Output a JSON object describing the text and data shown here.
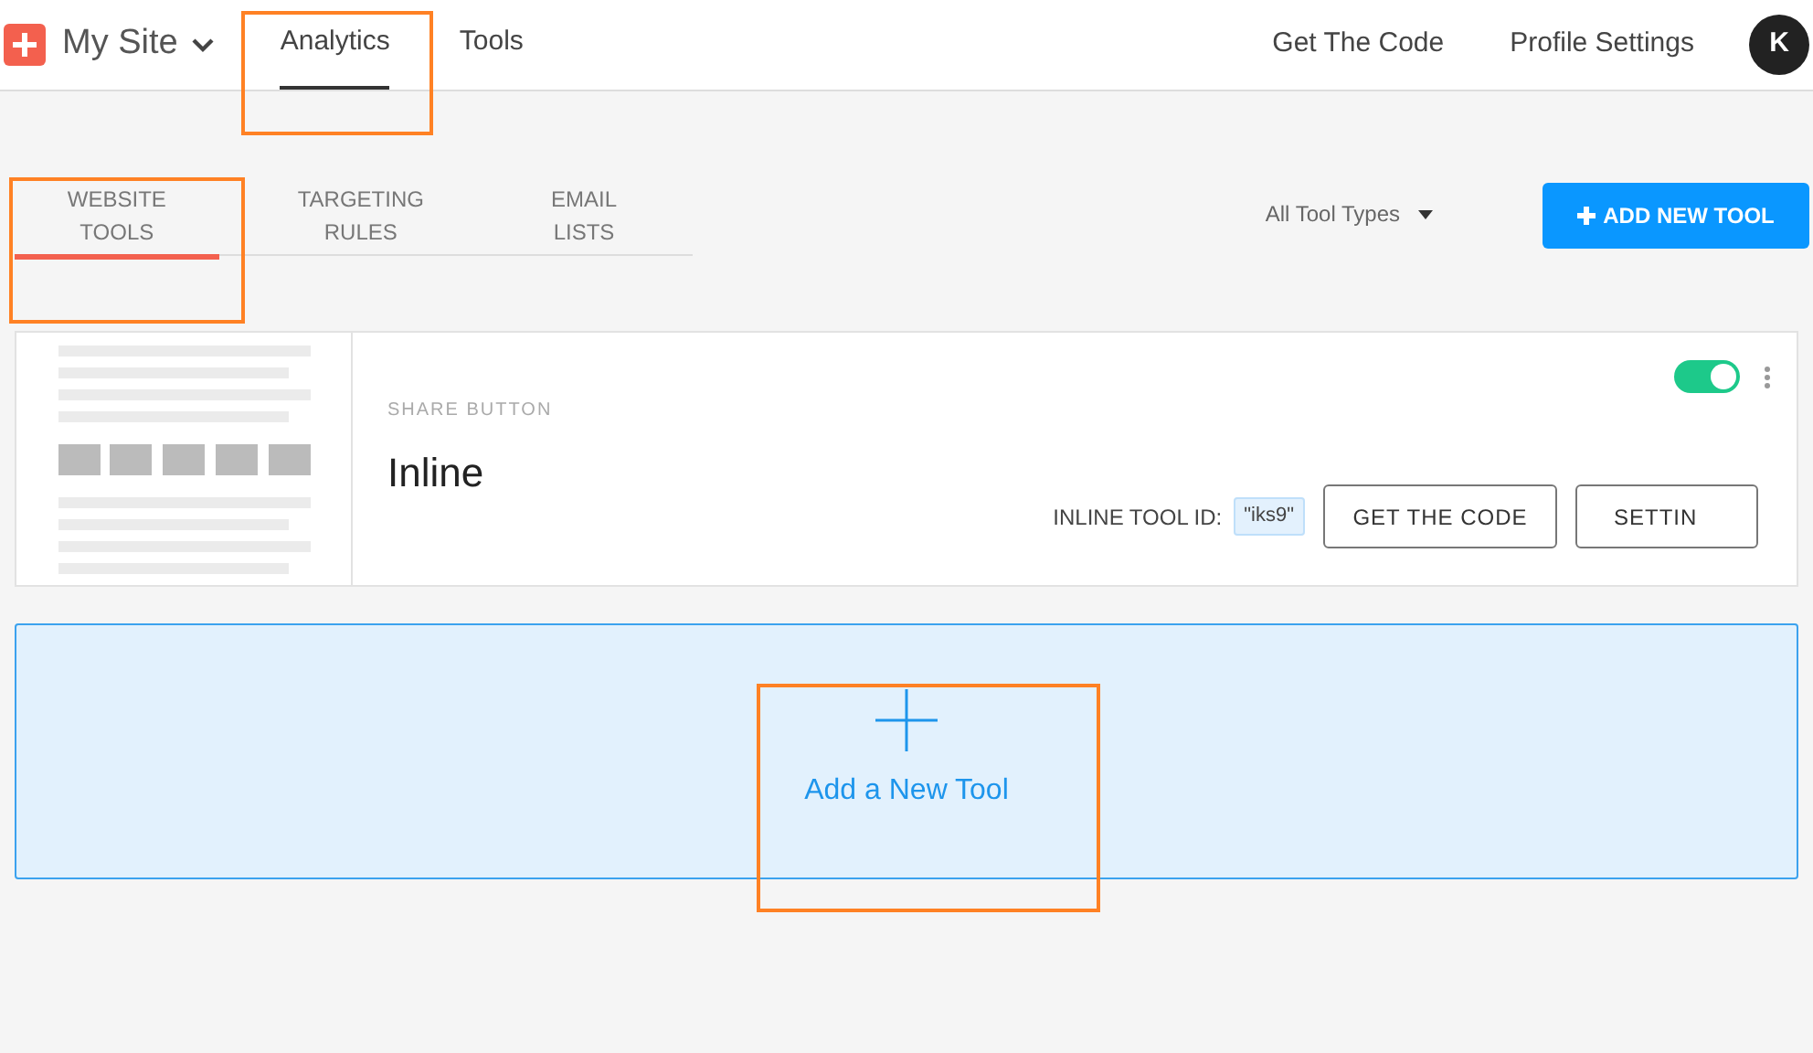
{
  "header": {
    "site": "My Site",
    "nav": [
      {
        "label": "Analytics",
        "selected": true
      },
      {
        "label": "Tools",
        "selected": false
      }
    ],
    "links": [
      "Get The Code",
      "Profile Settings"
    ],
    "avatar": "K"
  },
  "tabs": [
    {
      "label": "WEBSITE TOOLS",
      "selected": true
    },
    {
      "label": "TARGETING RULES",
      "selected": false
    },
    {
      "label": "EMAIL LISTS",
      "selected": false
    }
  ],
  "filter": {
    "value": "All Tool Types"
  },
  "add_button": "ADD NEW TOOL",
  "tools": [
    {
      "category": "SHARE BUTTON",
      "name": "Inline",
      "on": true,
      "id_label": "INLINE TOOL ID:",
      "id": "\"iks9\"",
      "buttons": [
        "GET THE CODE",
        "SETTIN"
      ]
    }
  ],
  "add_tile": {
    "label": "Add a New Tool"
  }
}
